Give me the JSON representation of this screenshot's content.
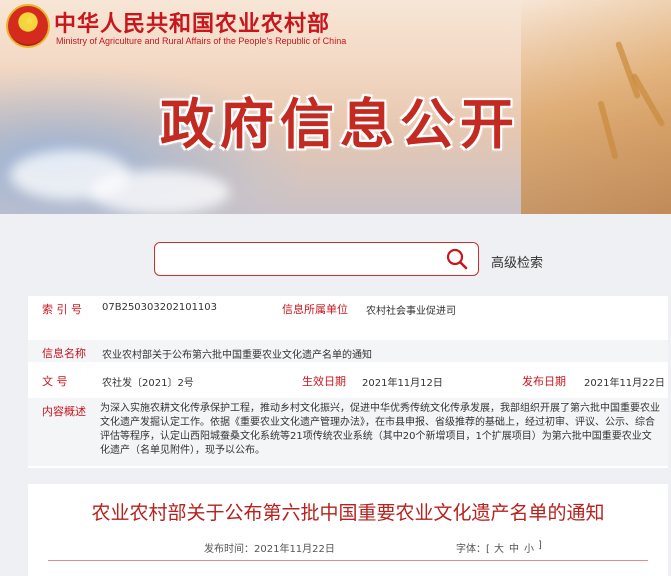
{
  "header": {
    "ministry_cn": "中华人民共和国农业农村部",
    "ministry_en": "Ministry of Agriculture and Rural Affairs of the People's Republic of China",
    "banner_title": "政府信息公开"
  },
  "search": {
    "placeholder": "",
    "advanced_label": "高级检索"
  },
  "info": {
    "index_label": "索 引 号",
    "index_value": "07B250303202101103",
    "unit_label": "信息所属单位",
    "unit_value": "农村社会事业促进司",
    "name_label": "信息名称",
    "name_value": "农业农村部关于公布第六批中国重要农业文化遗产名单的通知",
    "docno_label": "文      号",
    "docno_value": "农社发〔2021〕2号",
    "effective_label": "生效日期",
    "effective_value": "2021年11月12日",
    "publish_label": "发布日期",
    "publish_value": "2021年11月22日",
    "summary_label": "内容概述",
    "summary_value": "为深入实施农耕文化传承保护工程，推动乡村文化振兴，促进中华优秀传统文化传承发展，我部组织开展了第六批中国重要农业文化遗产发掘认定工作。依据《重要农业文化遗产管理办法》，在市县申报、省级推荐的基础上，经过初审、评议、公示、综合评估等程序，认定山西阳城蚕桑文化系统等21项传统农业系统（其中20个新增项目，1个扩展项目）为第六批中国重要农业文化遗产（名单见附件），现予以公布。"
  },
  "notice": {
    "title": "农业农村部关于公布第六批中国重要农业文化遗产名单的通知",
    "publish_time_label": "发布时间：",
    "publish_time_value": "2021年11月22日",
    "font_size_label": "字体：[",
    "font_large": "大",
    "font_medium": "中",
    "font_small": "小",
    "font_close": "]"
  },
  "colors": {
    "brand_red": "#c8161d",
    "title_red": "#b8211d"
  }
}
